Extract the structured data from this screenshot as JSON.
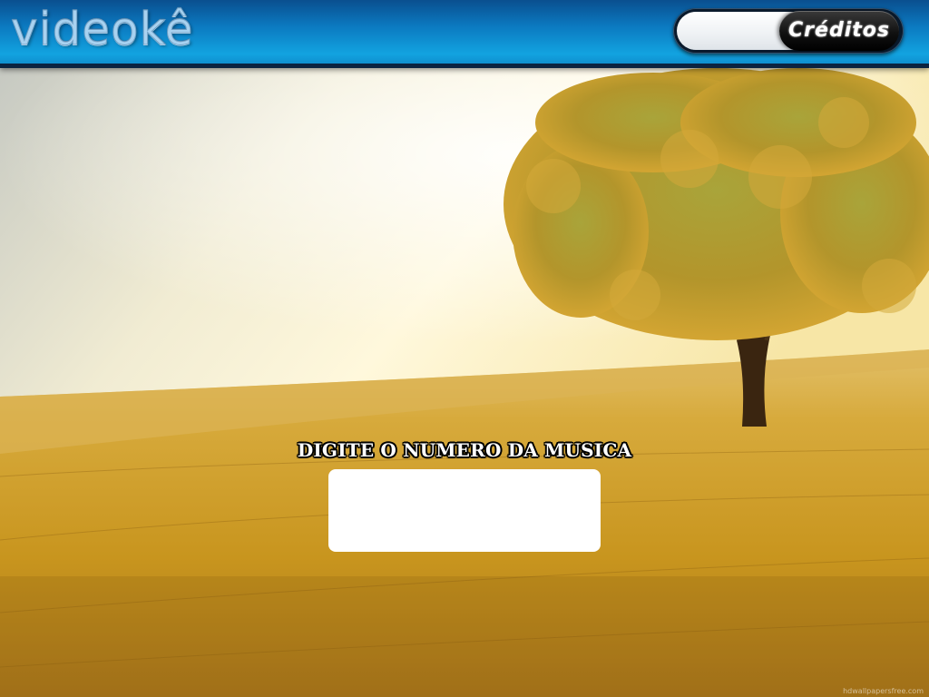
{
  "app": {
    "logo_text": "videokê"
  },
  "header": {
    "credits_value": "",
    "credits_button_label": "Créditos"
  },
  "main": {
    "prompt": "DIGITE O NUMERO DA MUSICA",
    "song_number_value": ""
  },
  "watermark": "hdwallpapersfree.com",
  "colors": {
    "header_top": "#0a4f8f",
    "header_bottom": "#12a3e0",
    "header_border": "#0b2340",
    "button": "#111111",
    "field_sky": "#efe8c6",
    "field_wheat": "#d9a92a"
  },
  "icons": {
    "background": "wheat-field-tree-image"
  }
}
